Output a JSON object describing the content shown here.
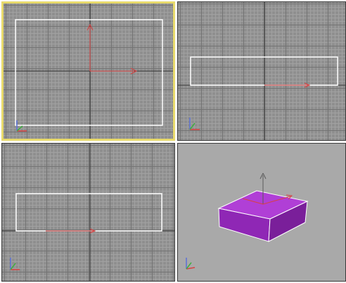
{
  "app": {
    "name": ""
  },
  "viewports": [
    {
      "id": "top",
      "label": "",
      "active": true,
      "grid": true
    },
    {
      "id": "front",
      "label": "",
      "active": false,
      "grid": true
    },
    {
      "id": "left",
      "label": "",
      "active": false,
      "grid": true
    },
    {
      "id": "perspective",
      "label": "",
      "active": false,
      "grid": false
    }
  ],
  "colors": {
    "grid_background": "#8f8f8f",
    "grid_major": "#747474",
    "grid_minor": "#a1a1a1",
    "grid_axis": "#2f2f2f",
    "perspective_background": "#a9a9a9",
    "active_border": "#e8da6c",
    "outline": "#ffffff",
    "gizmo_red": "#d94040",
    "box_top": "#b03fd6",
    "box_side": "#7a1f9a",
    "box_front": "#9a2fc0"
  },
  "icons": [
    "move-gizmo-icon",
    "axis-tripod-icon",
    "view-cube-icon"
  ]
}
